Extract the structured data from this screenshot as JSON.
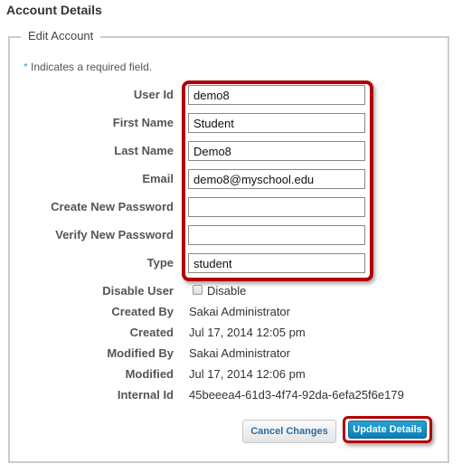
{
  "page": {
    "title": "Account Details"
  },
  "fieldset": {
    "legend": "Edit Account"
  },
  "required_note": {
    "star": "*",
    "text": " Indicates a required field."
  },
  "form": {
    "user_id": {
      "label": "User Id",
      "value": "demo8"
    },
    "first_name": {
      "label": "First Name",
      "value": "Student"
    },
    "last_name": {
      "label": "Last Name",
      "value": "Demo8"
    },
    "email": {
      "label": "Email",
      "value": "demo8@myschool.edu"
    },
    "create_password": {
      "label": "Create New Password",
      "value": ""
    },
    "verify_password": {
      "label": "Verify New Password",
      "value": ""
    },
    "type": {
      "label": "Type",
      "value": "student"
    },
    "disable_user": {
      "label": "Disable User",
      "checkbox_label": "Disable",
      "checked": false
    }
  },
  "info": {
    "created_by": {
      "label": "Created By",
      "value": "Sakai Administrator"
    },
    "created": {
      "label": "Created",
      "value": "Jul 17, 2014 12:05 pm"
    },
    "modified_by": {
      "label": "Modified By",
      "value": "Sakai Administrator"
    },
    "modified": {
      "label": "Modified",
      "value": "Jul 17, 2014 12:06 pm"
    },
    "internal_id": {
      "label": "Internal Id",
      "value": "45beeea4-61d3-4f74-92da-6efa25f6e179"
    }
  },
  "buttons": {
    "cancel": "Cancel Changes",
    "update": "Update Details"
  },
  "colors": {
    "highlight": "#b00000",
    "primary_button": "#0b7db5",
    "required_star": "#3a9ad9"
  }
}
